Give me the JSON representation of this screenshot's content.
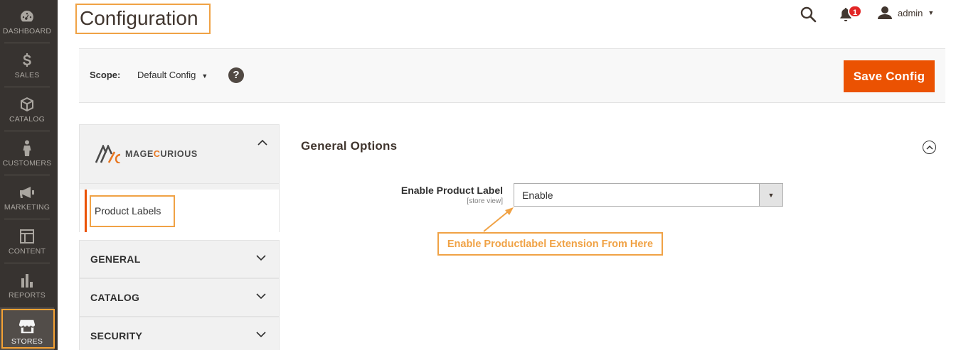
{
  "sidebar": {
    "items": [
      {
        "label": "DASHBOARD",
        "icon": "dashboard-icon"
      },
      {
        "label": "SALES",
        "icon": "dollar-icon"
      },
      {
        "label": "CATALOG",
        "icon": "cube-icon"
      },
      {
        "label": "CUSTOMERS",
        "icon": "person-icon"
      },
      {
        "label": "MARKETING",
        "icon": "megaphone-icon"
      },
      {
        "label": "CONTENT",
        "icon": "layout-icon"
      },
      {
        "label": "REPORTS",
        "icon": "bar-chart-icon"
      },
      {
        "label": "STORES",
        "icon": "store-icon",
        "active": true
      }
    ]
  },
  "header": {
    "title": "Configuration",
    "notification_count": "1",
    "user": "admin"
  },
  "scope": {
    "label": "Scope:",
    "value": "Default Config"
  },
  "actions": {
    "save_label": "Save Config"
  },
  "config_nav": {
    "brand": {
      "prefix": "MAGE",
      "accent": "C",
      "rest": "URIOUS"
    },
    "active_item": "Product Labels",
    "sections": [
      "GENERAL",
      "CATALOG",
      "SECURITY"
    ]
  },
  "main": {
    "section_title": "General Options",
    "field": {
      "label": "Enable Product Label",
      "scope": "[store view]",
      "value": "Enable"
    },
    "callout": "Enable Productlabel Extension From Here"
  },
  "colors": {
    "accent": "#eb5202",
    "highlight": "#f0a245",
    "sidebar": "#373330",
    "badge": "#e22626"
  }
}
